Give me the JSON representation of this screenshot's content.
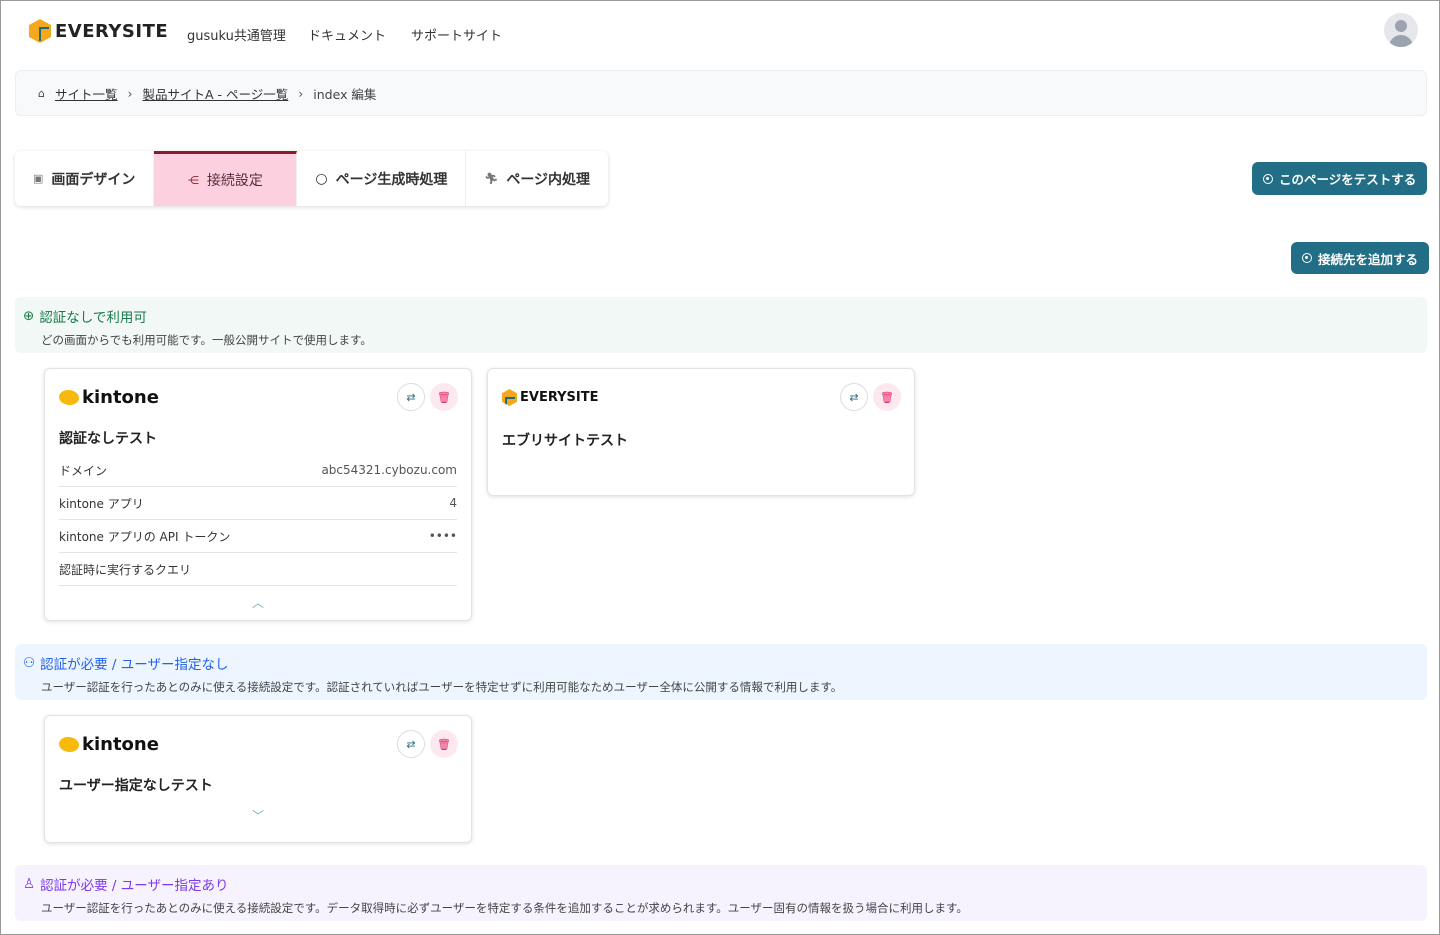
{
  "header": {
    "brand": "EVERYSITE",
    "nav": [
      "gusuku共通管理",
      "ドキュメント",
      "サポートサイト"
    ]
  },
  "breadcrumb": {
    "items": [
      "サイト一覧",
      "製品サイトA - ページ一覧"
    ],
    "current": "index 編集"
  },
  "tabs": [
    "画面デザイン",
    "接続設定",
    "ページ生成時処理",
    "ページ内処理"
  ],
  "buttons": {
    "test": "このページをテストする",
    "add": "接続先を追加する"
  },
  "sections": [
    {
      "title": "認証なしで利用可",
      "desc": "どの画面からでも利用可能です。一般公開サイトで使用します。",
      "color": "#1a7a4c"
    },
    {
      "title": "認証が必要 / ユーザー指定なし",
      "desc": "ユーザー認証を行ったあとのみに使える接続設定です。認証されていればユーザーを特定せずに利用可能なためユーザー全体に公開する情報で利用します。",
      "color": "#2563eb"
    },
    {
      "title": "認証が必要 / ユーザー指定あり",
      "desc": "ユーザー認証を行ったあとのみに使える接続設定です。データ取得時に必ずユーザーを特定する条件を追加することが求められます。ユーザー固有の情報を扱う場合に利用します。",
      "color": "#7c3aed"
    }
  ],
  "cards": {
    "c1": {
      "service": "kintone",
      "title": "認証なしテスト",
      "rows": [
        {
          "label": "ドメイン",
          "value": "abc54321.cybozu.com"
        },
        {
          "label": "kintone アプリ",
          "value": "4"
        },
        {
          "label": "kintone アプリの API トークン",
          "value": "••••"
        },
        {
          "label": "認証時に実行するクエリ",
          "value": ""
        }
      ]
    },
    "c2": {
      "service": "EVERYSITE",
      "title": "エブリサイトテスト"
    },
    "c3": {
      "service": "kintone",
      "title": "ユーザー指定なしテスト"
    }
  }
}
